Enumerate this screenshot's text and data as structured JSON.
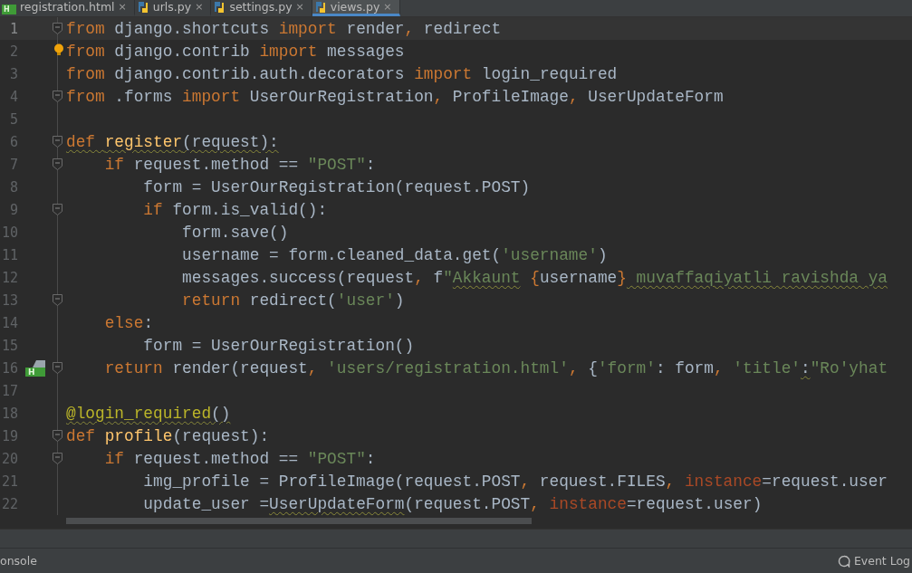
{
  "tabs": [
    {
      "label": "registration.html",
      "kind": "html",
      "icon_label": "H",
      "close": "×",
      "selected": false
    },
    {
      "label": "urls.py",
      "kind": "python",
      "close": "×",
      "selected": false
    },
    {
      "label": "settings.py",
      "kind": "python",
      "close": "×",
      "selected": false
    },
    {
      "label": "views.py",
      "kind": "python",
      "close": "×",
      "selected": true
    }
  ],
  "lines": [
    {
      "number": "1",
      "current": true,
      "fold": true,
      "tokens": [
        {
          "kind": "kw",
          "text": "from"
        },
        {
          "kind": "plain",
          "text": " django.shortcuts "
        },
        {
          "kind": "kw",
          "text": "import"
        },
        {
          "kind": "plain",
          "text": " render"
        },
        {
          "kind": "kw",
          "text": ","
        },
        {
          "kind": "plain",
          "text": " redirect"
        }
      ]
    },
    {
      "number": "2",
      "current": false,
      "fold": false,
      "gutter_icon": {
        "kind": "bulb"
      },
      "tokens": [
        {
          "kind": "kw",
          "text": "from"
        },
        {
          "kind": "plain",
          "text": " django.contrib "
        },
        {
          "kind": "kw",
          "text": "import"
        },
        {
          "kind": "plain",
          "text": " messages"
        }
      ]
    },
    {
      "number": "3",
      "current": false,
      "fold": false,
      "tokens": [
        {
          "kind": "kw",
          "text": "from"
        },
        {
          "kind": "plain",
          "text": " django.contrib.auth.decorators "
        },
        {
          "kind": "kw",
          "text": "import"
        },
        {
          "kind": "plain",
          "text": " login_required"
        }
      ]
    },
    {
      "number": "4",
      "current": false,
      "fold": true,
      "tokens": [
        {
          "kind": "kw",
          "text": "from"
        },
        {
          "kind": "plain",
          "text": " .forms "
        },
        {
          "kind": "kw",
          "text": "import"
        },
        {
          "kind": "plain",
          "text": " UserOurRegistration"
        },
        {
          "kind": "kw",
          "text": ","
        },
        {
          "kind": "plain",
          "text": " ProfileImage"
        },
        {
          "kind": "kw",
          "text": ","
        },
        {
          "kind": "plain",
          "text": " UserUpdateForm"
        }
      ]
    },
    {
      "number": "5",
      "current": false,
      "fold": false
    },
    {
      "number": "6",
      "current": false,
      "fold": true,
      "tokens": [
        {
          "kind": "kw",
          "text": "def ",
          "wavy": true
        },
        {
          "kind": "fn",
          "text": "register",
          "wavy": true
        },
        {
          "kind": "plain",
          "text": "(request):",
          "wavy": true
        }
      ]
    },
    {
      "number": "7",
      "current": false,
      "fold": true,
      "tokens": [
        {
          "kind": "kw",
          "text": "    if"
        },
        {
          "kind": "plain",
          "text": " request.method == "
        },
        {
          "kind": "str",
          "text": "\"POST\""
        },
        {
          "kind": "plain",
          "text": ":"
        }
      ]
    },
    {
      "number": "8",
      "current": false,
      "fold": false,
      "tokens": [
        {
          "kind": "plain",
          "text": "        form = UserOurRegistration(request.POST)"
        }
      ]
    },
    {
      "number": "9",
      "current": false,
      "fold": true,
      "tokens": [
        {
          "kind": "kw",
          "text": "        if"
        },
        {
          "kind": "plain",
          "text": " form.is_valid():"
        }
      ]
    },
    {
      "number": "10",
      "current": false,
      "fold": false,
      "tokens": [
        {
          "kind": "plain",
          "text": "            form.save()"
        }
      ]
    },
    {
      "number": "11",
      "current": false,
      "fold": false,
      "tokens": [
        {
          "kind": "plain",
          "text": "            username = form.cleaned_data.get("
        },
        {
          "kind": "str",
          "text": "'username'"
        },
        {
          "kind": "plain",
          "text": ")"
        }
      ]
    },
    {
      "number": "12",
      "current": false,
      "fold": false,
      "tokens": [
        {
          "kind": "plain",
          "text": "            messages.success(request"
        },
        {
          "kind": "kw",
          "text": ","
        },
        {
          "kind": "plain",
          "text": " f"
        },
        {
          "kind": "str",
          "text": "\""
        },
        {
          "kind": "str",
          "text": "Akkaunt",
          "wavy": true
        },
        {
          "kind": "kw",
          "text": " {"
        },
        {
          "kind": "plain",
          "text": "username"
        },
        {
          "kind": "kw",
          "text": "}"
        },
        {
          "kind": "str",
          "text": " muvaffaqiyatli ravishda ya",
          "wavy": true
        }
      ]
    },
    {
      "number": "13",
      "current": false,
      "fold": true,
      "tokens": [
        {
          "kind": "kw",
          "text": "            return"
        },
        {
          "kind": "plain",
          "text": " redirect("
        },
        {
          "kind": "str",
          "text": "'user'"
        },
        {
          "kind": "plain",
          "text": ")"
        }
      ]
    },
    {
      "number": "14",
      "current": false,
      "fold": false,
      "tokens": [
        {
          "kind": "kw",
          "text": "    else"
        },
        {
          "kind": "plain",
          "text": ":"
        }
      ]
    },
    {
      "number": "15",
      "current": false,
      "fold": false,
      "tokens": [
        {
          "kind": "plain",
          "text": "        form = UserOurRegistration()"
        }
      ]
    },
    {
      "number": "16",
      "current": false,
      "fold": true,
      "gutter_icon": {
        "kind": "html",
        "label": "H"
      },
      "tokens": [
        {
          "kind": "kw",
          "text": "    return"
        },
        {
          "kind": "plain",
          "text": " render(request"
        },
        {
          "kind": "kw",
          "text": ","
        },
        {
          "kind": "str",
          "text": " 'users/registration.html'"
        },
        {
          "kind": "kw",
          "text": ","
        },
        {
          "kind": "plain",
          "text": " {"
        },
        {
          "kind": "str",
          "text": "'form'"
        },
        {
          "kind": "plain",
          "text": ": form"
        },
        {
          "kind": "kw",
          "text": ","
        },
        {
          "kind": "str",
          "text": " 'title'"
        },
        {
          "kind": "plain",
          "text": ":",
          "wavy": true
        },
        {
          "kind": "str",
          "text": "\"Ro'yhat"
        }
      ]
    },
    {
      "number": "17",
      "current": false,
      "fold": false
    },
    {
      "number": "18",
      "current": false,
      "fold": false,
      "tokens": [
        {
          "kind": "deco",
          "text": "@login_required",
          "wavy": true
        },
        {
          "kind": "plain",
          "text": "()",
          "wavy": true
        }
      ]
    },
    {
      "number": "19",
      "current": false,
      "fold": true,
      "tokens": [
        {
          "kind": "kw",
          "text": "def"
        },
        {
          "kind": "fn",
          "text": " profile"
        },
        {
          "kind": "plain",
          "text": "(request):"
        }
      ]
    },
    {
      "number": "20",
      "current": false,
      "fold": true,
      "tokens": [
        {
          "kind": "kw",
          "text": "    if"
        },
        {
          "kind": "plain",
          "text": " request.method == "
        },
        {
          "kind": "str",
          "text": "\"POST\""
        },
        {
          "kind": "plain",
          "text": ":"
        }
      ]
    },
    {
      "number": "21",
      "current": false,
      "fold": false,
      "tokens": [
        {
          "kind": "plain",
          "text": "        img_profile = ProfileImage(request.POST"
        },
        {
          "kind": "kw",
          "text": ","
        },
        {
          "kind": "plain",
          "text": " request.FILES"
        },
        {
          "kind": "kw",
          "text": ","
        },
        {
          "kind": "param",
          "text": " instance"
        },
        {
          "kind": "plain",
          "text": "=request.user"
        }
      ]
    },
    {
      "number": "22",
      "current": false,
      "fold": false,
      "tokens": [
        {
          "kind": "plain",
          "text": "        update_user ="
        },
        {
          "kind": "plain",
          "text": "UserUpdateForm",
          "wavy": true
        },
        {
          "kind": "plain",
          "text": "(request.POST"
        },
        {
          "kind": "kw",
          "text": ","
        },
        {
          "kind": "param",
          "text": " instance"
        },
        {
          "kind": "plain",
          "text": "=request.user)"
        }
      ]
    }
  ],
  "status_bar": {
    "left": "onsole",
    "right": "Event Log"
  }
}
